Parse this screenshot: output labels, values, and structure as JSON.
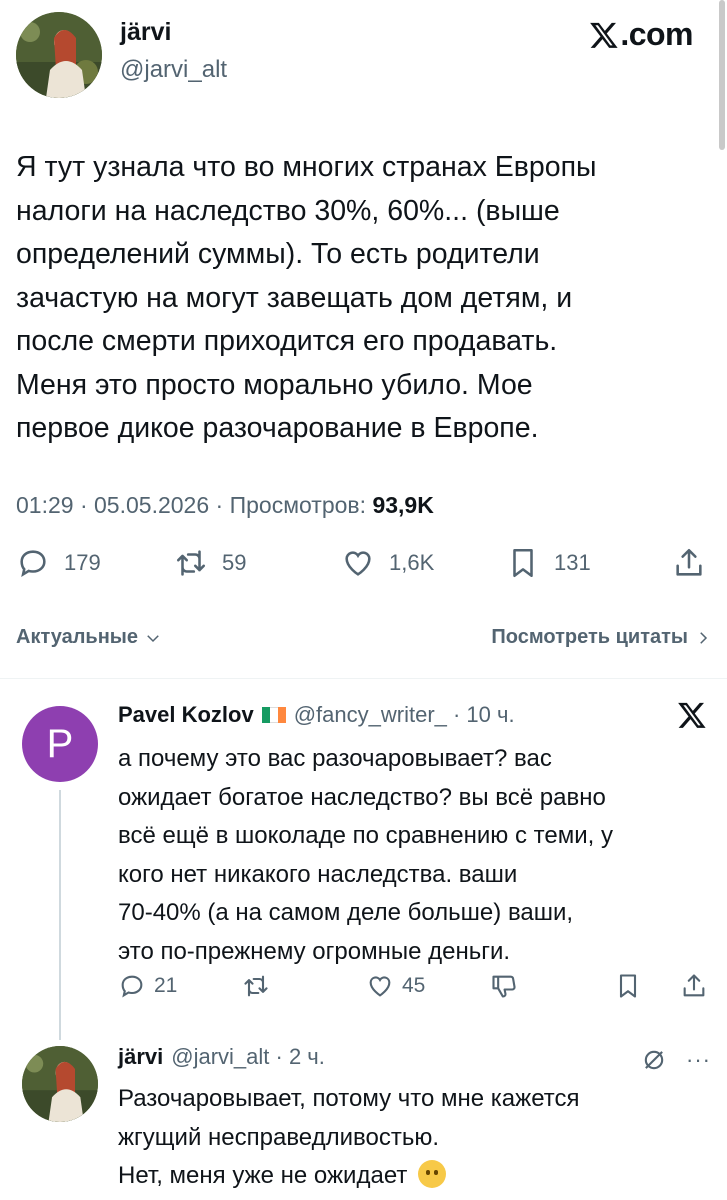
{
  "site": {
    "brand": "X.com"
  },
  "main_tweet": {
    "author_name": "järvi",
    "author_handle": "@jarvi_alt",
    "lines": [
      "Я тут узнала что во многих странах Европы",
      "налоги на наследство 30%, 60%... (выше",
      "определений суммы). То есть родители",
      "зачастую на могут завещать дом детям, и",
      "после смерти приходится его продавать.",
      "Меня это просто морально убило. Мое",
      "первое дикое разочарование в Европе."
    ],
    "time": "01:29",
    "date": "05.05.2026",
    "views_label": "Просмотров:",
    "views": "93,9K",
    "stats": {
      "replies": "179",
      "reposts": "59",
      "likes": "1,6K",
      "bookmarks": "131"
    }
  },
  "sort": {
    "left_label": "Актуальные",
    "right_label": "Посмотреть цитаты"
  },
  "reply1": {
    "avatar_letter": "P",
    "author_name": "Pavel Kozlov",
    "handle_time": "@fancy_writer_ · 10 ч.",
    "lines": [
      "а почему это вас разочаровывает? вас",
      "ожидает богатое наследство? вы всё равно",
      "всё ещё в шоколаде по сравнению с теми, у",
      "кого нет никакого наследства. ваши",
      "70-40% (а на самом деле больше) ваши,",
      "это по-прежнему огромные деньги."
    ],
    "stats": {
      "replies": "21",
      "likes": "45"
    },
    "colors": {
      "avatar": "#8e3fb0"
    }
  },
  "reply2": {
    "author_name": "järvi",
    "handle_time": "@jarvi_alt · 2 ч.",
    "lines": [
      "Разочаровывает, потому что мне кажется",
      "жгущий несправедливостью.",
      "Нет, меня уже не ожидает"
    ],
    "more": "···"
  }
}
